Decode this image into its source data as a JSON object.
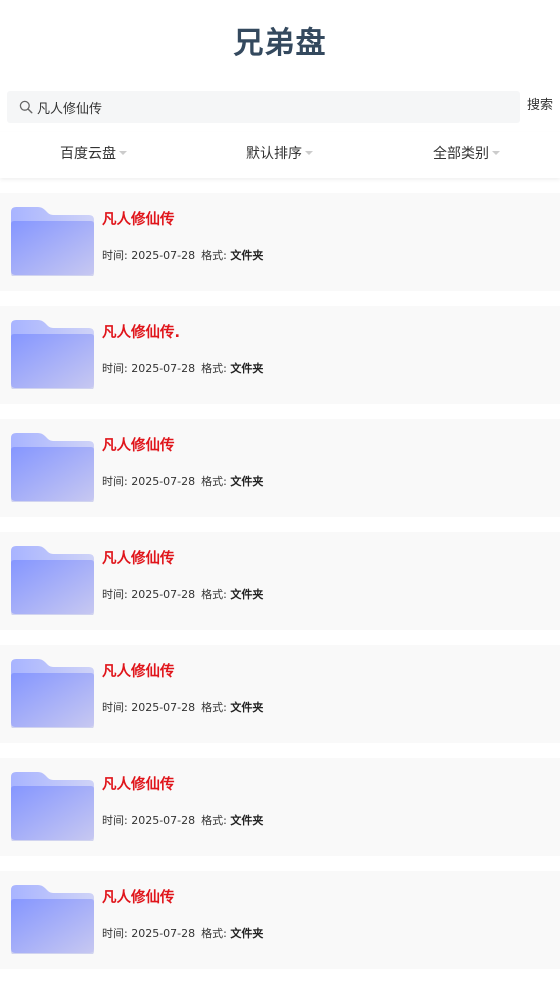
{
  "header": {
    "title": "兄弟盘"
  },
  "search": {
    "value": "凡人修仙传",
    "placeholder": "",
    "button_label": "搜索"
  },
  "filters": [
    {
      "label": "百度云盘"
    },
    {
      "label": "默认排序"
    },
    {
      "label": "全部类别"
    }
  ],
  "meta_labels": {
    "time": "时间:",
    "format": "格式:"
  },
  "results": [
    {
      "title": "凡人修仙传",
      "time": "2025-07-28",
      "format": "文件夹"
    },
    {
      "title": "凡人修仙传.",
      "time": "2025-07-28",
      "format": "文件夹"
    },
    {
      "title": "凡人修仙传",
      "time": "2025-07-28",
      "format": "文件夹"
    },
    {
      "title": "凡人修仙传",
      "time": "2025-07-28",
      "format": "文件夹"
    },
    {
      "title": "凡人修仙传",
      "time": "2025-07-28",
      "format": "文件夹"
    },
    {
      "title": "凡人修仙传",
      "time": "2025-07-28",
      "format": "文件夹"
    },
    {
      "title": "凡人修仙传",
      "time": "2025-07-28",
      "format": "文件夹"
    }
  ],
  "colors": {
    "title": "#34495e",
    "result_title": "#e0151b",
    "folder": "#8a9bff"
  }
}
